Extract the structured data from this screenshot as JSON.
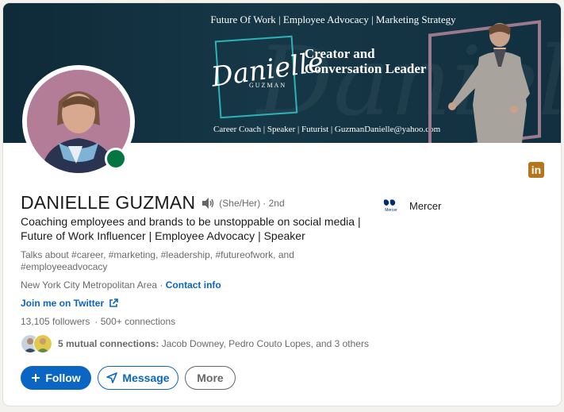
{
  "banner": {
    "tagline": "Future Of Work | Employee Advocacy | Marketing Strategy",
    "logo_script": "Danielle",
    "logo_sub": "GUZMAN",
    "headline_line1": "Creator and",
    "headline_line2": "Conversation Leader",
    "contact_line": "Career Coach | Speaker | Futurist | GuzmanDanielle@yahoo.com",
    "watermark": "Danielle"
  },
  "profile": {
    "name": "DANIELLE GUZMAN",
    "pronouns": "(She/Her)",
    "degree": "· 2nd",
    "headline": "Coaching employees and brands to be unstoppable on social media | Future of Work Influencer | Employee Advocacy | Speaker",
    "talks_about": "Talks about #career, #marketing, #leadership, #futureofwork, and #employeeadvocacy",
    "location": "New York City Metropolitan Area",
    "separator": " · ",
    "contact_info": "Contact info",
    "twitter_link": "Join me on Twitter",
    "followers": "13,105 followers",
    "connections": "· 500+ connections",
    "mutual_bold": "5 mutual connections:",
    "mutual_rest": " Jacob Downey, Pedro Couto Lopes, and 3 others",
    "online_status": "online"
  },
  "company": {
    "name": "Mercer",
    "logo_text": "Mercer"
  },
  "badge": {
    "label": "in"
  },
  "actions": {
    "follow": "Follow",
    "message": "Message",
    "more": "More"
  },
  "colors": {
    "primary": "#0a66c2",
    "banner": "#12303f",
    "online": "#057642",
    "badge": "#b5761b"
  }
}
